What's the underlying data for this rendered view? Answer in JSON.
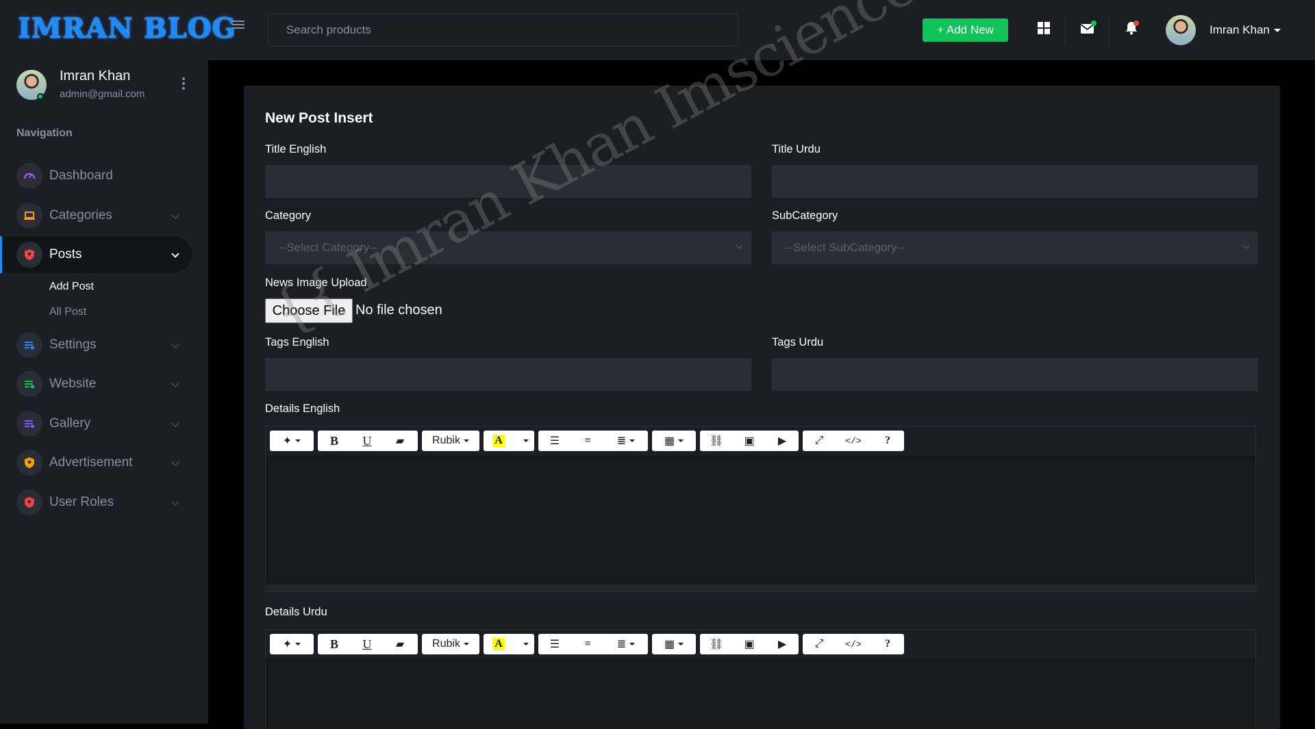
{
  "app": {
    "logo": "IMRAN BLOG",
    "search_placeholder": "Search products",
    "add_new_label": "+ Add New",
    "user_name": "Imran Khan"
  },
  "sidebar": {
    "user_name": "Imran Khan",
    "user_email": "admin@gmail.com",
    "nav_heading": "Navigation",
    "items": [
      {
        "label": "Dashboard",
        "icon": "speedometer-icon",
        "color": "#a855f7"
      },
      {
        "label": "Categories",
        "icon": "laptop-icon",
        "color": "#f59e0b"
      },
      {
        "label": "Posts",
        "icon": "shield-icon",
        "color": "#ef4444"
      },
      {
        "label": "Settings",
        "icon": "list-icon",
        "color": "#1b8cff"
      },
      {
        "label": "Website",
        "icon": "list-icon",
        "color": "#11c45a"
      },
      {
        "label": "Gallery",
        "icon": "list-icon",
        "color": "#7c5cff"
      },
      {
        "label": "Advertisement",
        "icon": "shield-icon",
        "color": "#f59e0b"
      },
      {
        "label": "User Roles",
        "icon": "shield-icon",
        "color": "#ef4444"
      }
    ],
    "sub_items": [
      "Add Post",
      "All Post"
    ]
  },
  "form": {
    "title": "New Post Insert",
    "title_english_label": "Title English",
    "title_urdu_label": "Title Urdu",
    "category_label": "Category",
    "category_placeholder": "--Select Category--",
    "subcategory_label": "SubCategory",
    "subcategory_placeholder": "--Select SubCategory--",
    "image_label": "News Image Upload",
    "choose_file_label": "Choose File",
    "no_file_text": "No file chosen",
    "tags_english_label": "Tags English",
    "tags_urdu_label": "Tags Urdu",
    "details_english_label": "Details English",
    "details_urdu_label": "Details Urdu",
    "font_name": "Rubik",
    "highlight_letter": "A"
  },
  "watermark": "{{ Imran Khan Imsciences }}",
  "colors": {
    "accent": "#1b8cff",
    "add_new": "#11c45a",
    "bg": "#1c1e25",
    "input_bg": "#2a2d35"
  }
}
